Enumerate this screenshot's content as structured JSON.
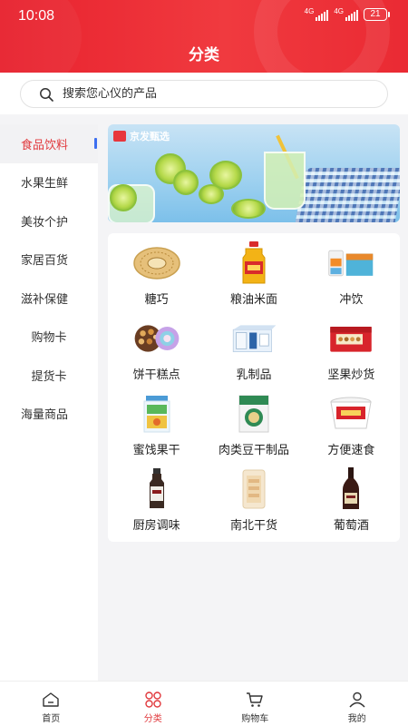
{
  "status": {
    "time": "10:08",
    "network1": "4G",
    "network2": "4G",
    "battery": "21"
  },
  "header": {
    "title": "分类"
  },
  "search": {
    "placeholder": "搜索您心仪的产品"
  },
  "sidebar": {
    "items": [
      {
        "label": "食品饮料",
        "active": true
      },
      {
        "label": "水果生鲜"
      },
      {
        "label": "美妆个护"
      },
      {
        "label": "家居百货"
      },
      {
        "label": "滋补保健"
      },
      {
        "label": "购物卡"
      },
      {
        "label": "提货卡"
      },
      {
        "label": "海量商品"
      }
    ]
  },
  "banner": {
    "brand": "京发甄选"
  },
  "categories": [
    {
      "label": "糖巧",
      "icon": "cookie-tin-icon"
    },
    {
      "label": "粮油米面",
      "icon": "oil-bottle-icon"
    },
    {
      "label": "冲饮",
      "icon": "drink-box-icon"
    },
    {
      "label": "饼干糕点",
      "icon": "biscuit-plate-icon"
    },
    {
      "label": "乳制品",
      "icon": "milk-box-icon"
    },
    {
      "label": "坚果炒货",
      "icon": "nut-gift-box-icon"
    },
    {
      "label": "蜜饯果干",
      "icon": "dried-fruit-jar-icon"
    },
    {
      "label": "肉类豆干制品",
      "icon": "meat-pack-icon"
    },
    {
      "label": "方便速食",
      "icon": "instant-noodle-cup-icon"
    },
    {
      "label": "厨房调味",
      "icon": "sauce-bottle-icon"
    },
    {
      "label": "南北干货",
      "icon": "dry-goods-bag-icon"
    },
    {
      "label": "葡萄酒",
      "icon": "wine-bottle-icon"
    }
  ],
  "nav": {
    "items": [
      {
        "label": "首页",
        "icon": "home-icon"
      },
      {
        "label": "分类",
        "icon": "category-icon",
        "active": true
      },
      {
        "label": "购物车",
        "icon": "cart-icon"
      },
      {
        "label": "我的",
        "icon": "user-icon"
      }
    ]
  },
  "colors": {
    "brand_red": "#e8222e",
    "active_red": "#e13a3e",
    "indicator_blue": "#3d6ff0"
  }
}
